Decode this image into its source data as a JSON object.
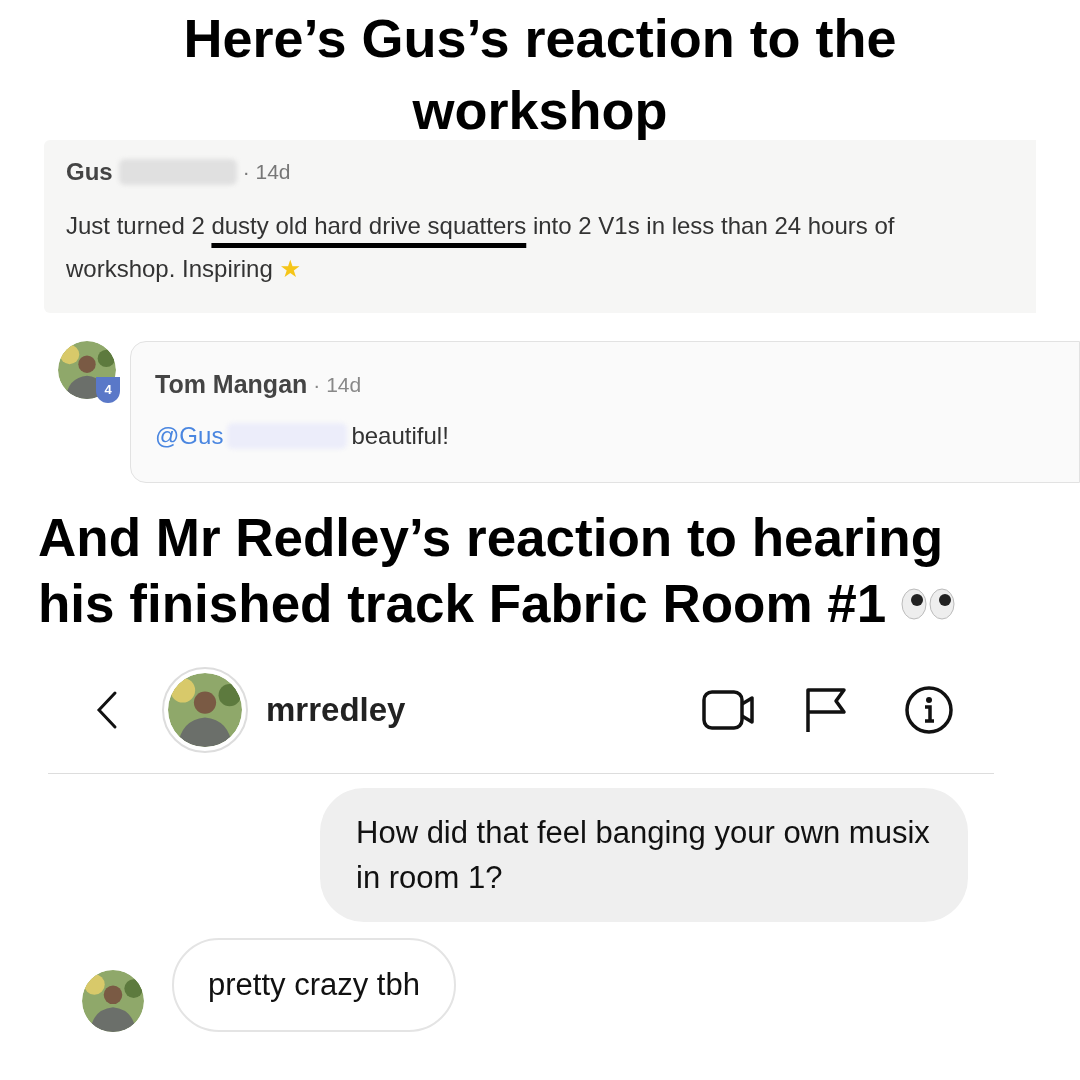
{
  "headline_1": "Here’s Gus’s reaction to the workshop",
  "post": {
    "author": "Gus",
    "time": "· 14d",
    "text_before": "Just turned 2 ",
    "text_marked": "dusty old hard drive squatters",
    "text_after": " into 2 V1s in less than 24 hours of workshop. Inspiring",
    "star": "★"
  },
  "comment": {
    "author": "Tom Mangan",
    "time": "· 14d",
    "badge": "4",
    "mention": "@Gus",
    "text": "beautiful!"
  },
  "headline_2": [
    "And Mr Redley’s reaction to hearing",
    "his finished track Fabric Room #1"
  ],
  "chat": {
    "username": "mrredley",
    "messages": [
      {
        "kind": "sent",
        "text": "How did that feel banging your own musix in room 1?"
      },
      {
        "kind": "received",
        "text": "pretty crazy tbh"
      }
    ]
  }
}
